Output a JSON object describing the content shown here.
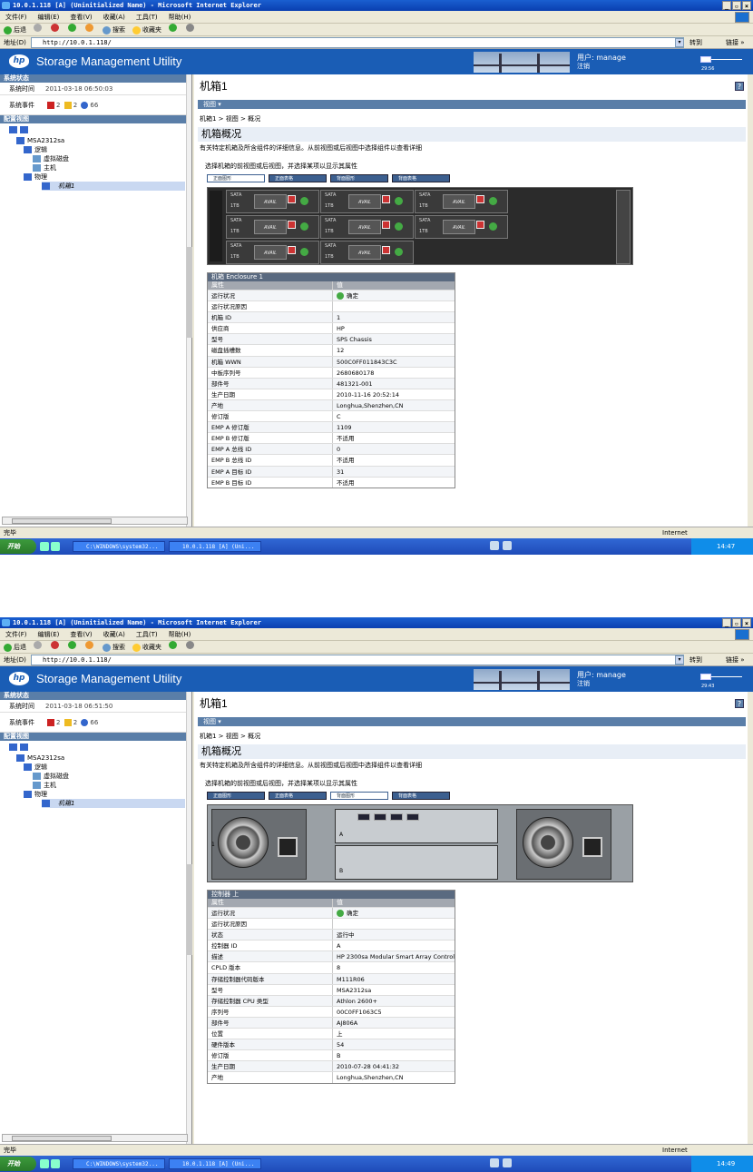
{
  "browser": {
    "title": "10.0.1.118 [A] (Uninitialized Name) - Microsoft Internet Explorer",
    "menu": [
      "文件(F)",
      "编辑(E)",
      "查看(V)",
      "收藏(A)",
      "工具(T)",
      "帮助(H)"
    ],
    "toolbar": [
      "后退",
      "",
      "",
      "",
      "",
      "搜索",
      "收藏夹",
      "",
      ""
    ],
    "address_label": "地址(D)",
    "url": "http://10.0.1.118/",
    "go_label": "转到",
    "links_label": "链接 »",
    "status_text": "完毕",
    "zone": "Internet"
  },
  "app": {
    "title": "Storage Management Utility",
    "hp_logo": "hp",
    "user_label": "用户: manage",
    "logout": "注销"
  },
  "taskbar": {
    "start": "开始",
    "tasks": [
      "C:\\WINDOWS\\system32...",
      "10.0.1.118 [A] (Uni..."
    ]
  },
  "shots": [
    {
      "clock": "14:47",
      "header_time": "29:56",
      "left": {
        "sys_status_hdr": "系统状态",
        "sys_time_label": "系统时间",
        "sys_time": "2011-03-18 06:50:03",
        "sys_events_label": "系统事件",
        "events": [
          "2",
          "2",
          "66"
        ],
        "config_hdr": "配置视图",
        "tree": [
          "MSA2312sa",
          "逻辑",
          "虚拟磁盘",
          "主机",
          "物理",
          "机箱1"
        ]
      },
      "main": {
        "page_title": "机箱1",
        "view_bar": "视图 ▾",
        "breadcrumb": "机箱1 > 视图 > 概况",
        "subhdr": "机箱概况",
        "desc": "有关特定机箱及所含组件的详细信息。从前视图或后视图中选择组件以查看详细",
        "hint": "选择机箱的前视图或后视图，并选择某项以显示其属性",
        "tabs": [
          "正面图形",
          "正面表格",
          "背面图形",
          "背面表格"
        ],
        "active_tab": 0,
        "bays": [
          {
            "t": "SATA",
            "s": "1TB",
            "a": "AVAIL"
          },
          {
            "t": "SATA",
            "s": "1TB",
            "a": "AVAIL"
          },
          {
            "t": "SATA",
            "s": "1TB",
            "a": "AVAIL"
          },
          {
            "t": "SATA",
            "s": "1TB",
            "a": "AVAIL"
          },
          {
            "t": "SATA",
            "s": "1TB",
            "a": "AVAIL"
          },
          {
            "t": "SATA",
            "s": "1TB",
            "a": "AVAIL"
          },
          {
            "t": "SATA",
            "s": "1TB",
            "a": "AVAIL"
          },
          {
            "t": "SATA",
            "s": "1TB",
            "a": "AVAIL"
          }
        ],
        "table_caption": "机箱 Enclosure 1",
        "table_head": [
          "属性",
          "值"
        ],
        "rows": [
          [
            "运行状况",
            "确定"
          ],
          [
            "运行状况原因",
            ""
          ],
          [
            "机箱 ID",
            "1"
          ],
          [
            "供应商",
            "HP"
          ],
          [
            "型号",
            "SPS Chassis"
          ],
          [
            "磁盘插槽数",
            "12"
          ],
          [
            "机箱 WWN",
            "500C0FF011843C3C"
          ],
          [
            "中板序列号",
            "2680680178"
          ],
          [
            "部件号",
            "481321-001"
          ],
          [
            "生产日期",
            "2010-11-16 20:52:14"
          ],
          [
            "产地",
            "Longhua,Shenzhen,CN"
          ],
          [
            "修订版",
            "C"
          ],
          [
            "EMP A 修订版",
            "1109"
          ],
          [
            "EMP B 修订版",
            "不适用"
          ],
          [
            "EMP A 总线 ID",
            "0"
          ],
          [
            "EMP B 总线 ID",
            "不适用"
          ],
          [
            "EMP A 目标 ID",
            "31"
          ],
          [
            "EMP B 目标 ID",
            "不适用"
          ]
        ]
      }
    },
    {
      "clock": "14:49",
      "header_time": "29:43",
      "left": {
        "sys_status_hdr": "系统状态",
        "sys_time_label": "系统时间",
        "sys_time": "2011-03-18 06:51:50",
        "sys_events_label": "系统事件",
        "events": [
          "2",
          "2",
          "66"
        ],
        "config_hdr": "配置视图",
        "tree": [
          "MSA2312sa",
          "逻辑",
          "虚拟磁盘",
          "主机",
          "物理",
          "机箱1"
        ]
      },
      "main": {
        "page_title": "机箱1",
        "view_bar": "视图 ▾",
        "breadcrumb": "机箱1 > 视图 > 概况",
        "subhdr": "机箱概况",
        "desc": "有关特定机箱及所含组件的详细信息。从前视图或后视图中选择组件以查看详细",
        "hint": "选择机箱的前视图或后视图，并选择某项以显示其属性",
        "tabs": [
          "正面图形",
          "正面表格",
          "背面图形",
          "背面表格"
        ],
        "active_tab": 2,
        "rear_labels": [
          "A",
          "B",
          "1"
        ],
        "table_caption": "控制器 上",
        "table_head": [
          "属性",
          "值"
        ],
        "rows": [
          [
            "运行状况",
            "确定"
          ],
          [
            "运行状况原因",
            ""
          ],
          [
            "状态",
            "运行中"
          ],
          [
            "控制器 ID",
            "A"
          ],
          [
            "描述",
            "HP 2300sa Modular Smart Array Controller"
          ],
          [
            "CPLD 版本",
            "8"
          ],
          [
            "存储控制器代码版本",
            "M111R06"
          ],
          [
            "型号",
            "MSA2312sa"
          ],
          [
            "存储控制器 CPU 类型",
            "Athlon 2600+"
          ],
          [
            "序列号",
            "00C0FF1063C5"
          ],
          [
            "部件号",
            "AJ806A"
          ],
          [
            "位置",
            "上"
          ],
          [
            "硬件版本",
            "54"
          ],
          [
            "修订版",
            "B"
          ],
          [
            "生产日期",
            "2010-07-28 04:41:32"
          ],
          [
            "产地",
            "Longhua,Shenzhen,CN"
          ]
        ]
      }
    }
  ],
  "colors": {
    "titlebar": "#0a3fb0",
    "header": "#1a5db5",
    "panel_hdr": "#5a7ea8",
    "taskbar": "#1e4bb8"
  }
}
